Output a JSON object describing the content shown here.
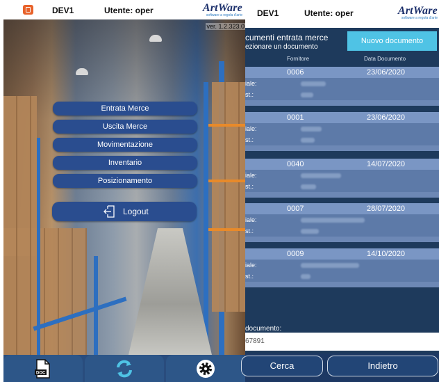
{
  "screen1": {
    "header": {
      "device": "DEV1",
      "user": "Utente: oper",
      "logo": "ArtWare",
      "logo_tagline": "software a regola d'arte"
    },
    "version": "ver. 1.2.323.0",
    "menu": [
      "Entrata Merce",
      "Uscita Merce",
      "Movimentazione",
      "Inventario",
      "Posizionamento"
    ],
    "logout_label": "Logout",
    "tabs": [
      {
        "icon": "doc-file-icon",
        "label": "DOC"
      },
      {
        "icon": "sync-icon"
      },
      {
        "icon": "gear-icon"
      }
    ]
  },
  "screen2": {
    "header": {
      "device": "DEV1",
      "user": "Utente: oper",
      "logo": "ArtWare",
      "logo_tagline": "software a regola d'arte"
    },
    "title_line1": "cumenti entrata merce",
    "title_line2": "ezionare un documento",
    "new_button": "Nuovo documento",
    "columns": {
      "supplier": "Fornitore",
      "date": "Data Documento"
    },
    "row_labels": {
      "l1": "iale:",
      "l2": "st.:"
    },
    "documents": [
      {
        "number": "0006",
        "date": "23/06/2020"
      },
      {
        "number": "0001",
        "date": "23/06/2020"
      },
      {
        "number": "0040",
        "date": "14/07/2020"
      },
      {
        "number": "0007",
        "date": "28/07/2020"
      },
      {
        "number": "0009",
        "date": "14/10/2020"
      }
    ],
    "doc_field_label": "documento:",
    "doc_field_value": "67891",
    "search_button": "Cerca",
    "back_button": "Indietro"
  },
  "colors": {
    "menu_button": "#2a4d8f",
    "list_background": "#1e3a5c",
    "accent": "#4fc3e5",
    "app_icon": "#e8622a"
  }
}
